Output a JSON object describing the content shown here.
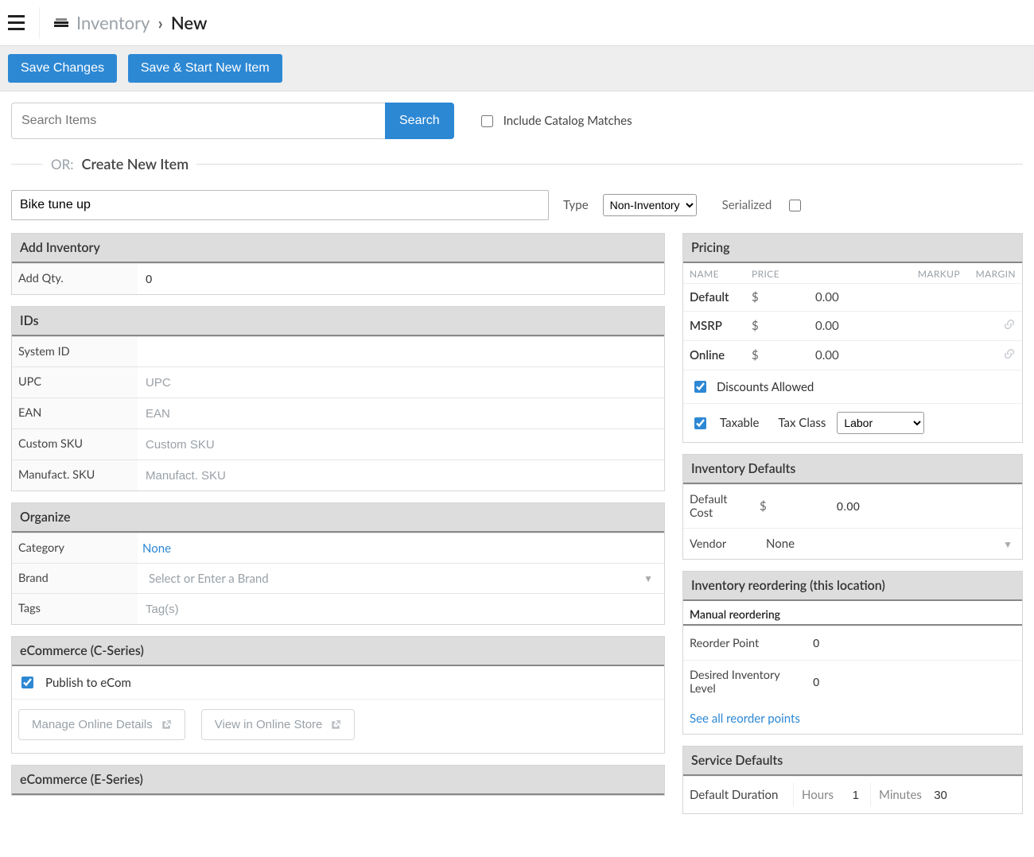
{
  "breadcrumb": {
    "parent": "Inventory",
    "current": "New"
  },
  "actions": {
    "save": "Save Changes",
    "save_new": "Save & Start New Item"
  },
  "search": {
    "placeholder": "Search Items",
    "button": "Search",
    "catalog_label": "Include Catalog Matches"
  },
  "divider": {
    "or": "OR:",
    "create": "Create New Item"
  },
  "item": {
    "name": "Bike tune up",
    "type_label": "Type",
    "type_value": "Non-Inventory",
    "serial_label": "Serialized"
  },
  "add_inventory": {
    "header": "Add Inventory",
    "qty_label": "Add Qty.",
    "qty_value": "0"
  },
  "ids": {
    "header": "IDs",
    "system_id_label": "System ID",
    "upc_label": "UPC",
    "upc_ph": "UPC",
    "ean_label": "EAN",
    "ean_ph": "EAN",
    "csku_label": "Custom SKU",
    "csku_ph": "Custom SKU",
    "msku_label": "Manufact. SKU",
    "msku_ph": "Manufact. SKU"
  },
  "organize": {
    "header": "Organize",
    "category_label": "Category",
    "category_value": "None",
    "brand_label": "Brand",
    "brand_ph": "Select or Enter a Brand",
    "tags_label": "Tags",
    "tags_ph": "Tag(s)"
  },
  "ecom_c": {
    "header": "eCommerce (C-Series)",
    "publish_label": "Publish to eCom",
    "manage_btn": "Manage Online Details",
    "view_btn": "View in Online Store"
  },
  "ecom_e": {
    "header": "eCommerce (E-Series)"
  },
  "pricing": {
    "header": "Pricing",
    "cols": {
      "name": "NAME",
      "price": "PRICE",
      "markup": "MARKUP",
      "margin": "MARGIN"
    },
    "rows": [
      {
        "name": "Default",
        "cur": "$",
        "val": "0.00"
      },
      {
        "name": "MSRP",
        "cur": "$",
        "val": "0.00",
        "linked": true
      },
      {
        "name": "Online",
        "cur": "$",
        "val": "0.00",
        "linked": true
      }
    ],
    "discounts_label": "Discounts Allowed",
    "taxable_label": "Taxable",
    "tax_class_label": "Tax Class",
    "tax_class_value": "Labor"
  },
  "inv_defaults": {
    "header": "Inventory Defaults",
    "cost_label": "Default Cost",
    "cost_cur": "$",
    "cost_val": "0.00",
    "vendor_label": "Vendor",
    "vendor_value": "None"
  },
  "reorder": {
    "header": "Inventory reordering (this location)",
    "sub": "Manual reordering",
    "point_label": "Reorder Point",
    "point_val": "0",
    "desired_label": "Desired Inventory Level",
    "desired_val": "0",
    "all_link": "See all reorder points"
  },
  "service": {
    "header": "Service Defaults",
    "duration_label": "Default Duration",
    "hours_label": "Hours",
    "hours_val": "1",
    "minutes_label": "Minutes",
    "minutes_val": "30"
  }
}
